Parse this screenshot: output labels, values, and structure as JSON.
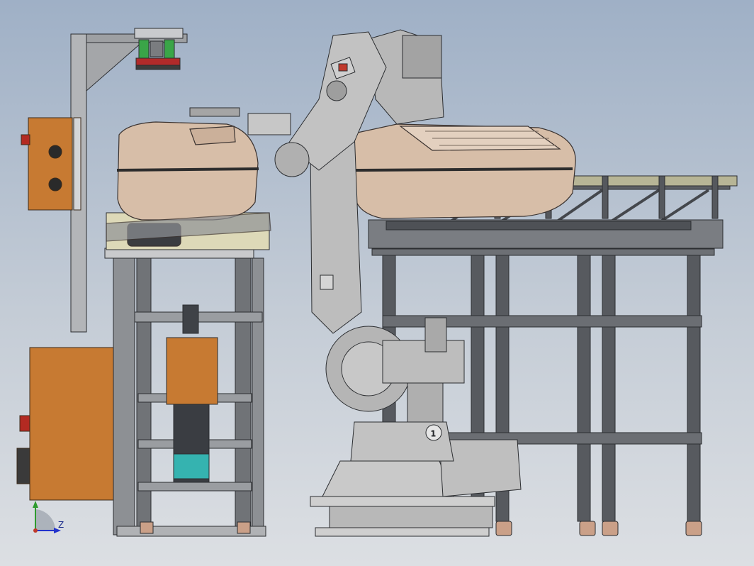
{
  "viewport": {
    "axis_triad": {
      "horizontal_axis_label": "Z"
    },
    "robot": {
      "base_badge": "1"
    }
  },
  "colors": {
    "background_top": "#9fb0c6",
    "background_bottom": "#dcdfe3",
    "frame_steel": "#5b5e63",
    "robot_body": "#bdbdbd",
    "tank_beige": "#d9c2ad",
    "electrical_box_orange": "#c77a32",
    "spring_green": "#3aa548",
    "cylinder_teal": "#35b3b0",
    "axis_y": "#2e9b2e",
    "axis_z": "#2233cc"
  },
  "icons": [
    "axis-triad-icon",
    "emergency-stop-icon"
  ]
}
